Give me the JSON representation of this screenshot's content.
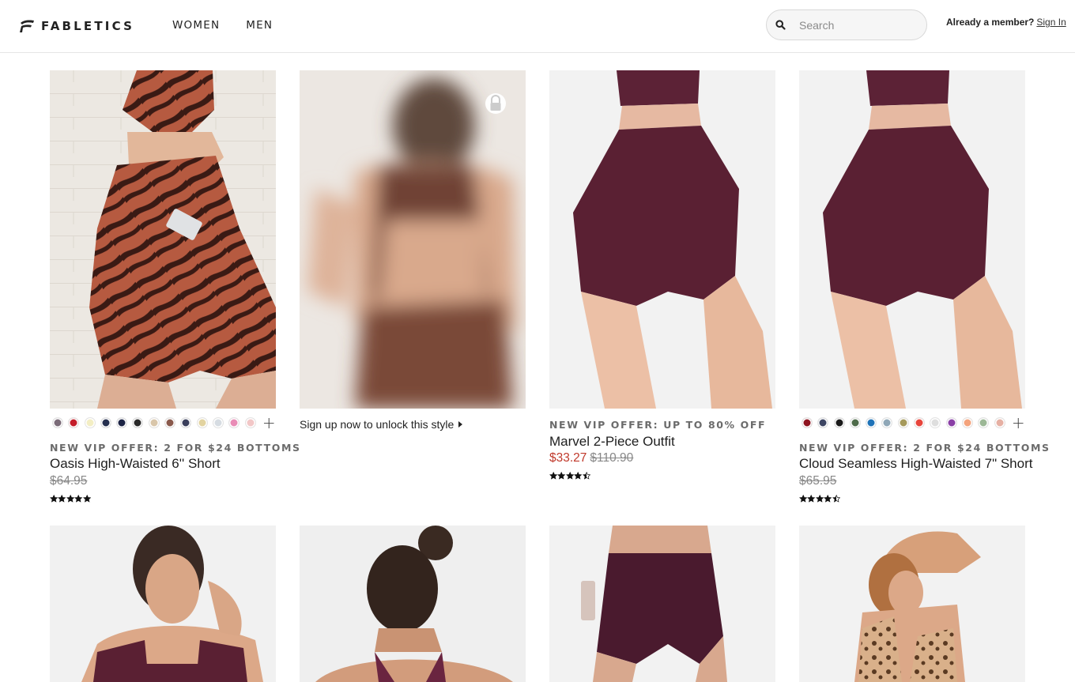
{
  "brand": "FABLETICS",
  "nav": [
    "WOMEN",
    "MEN"
  ],
  "search": {
    "placeholder": "Search"
  },
  "member": {
    "text": "Already a member?",
    "link": "Sign In"
  },
  "products": [
    {
      "offer": "NEW VIP OFFER: 2 FOR $24 BOTTOMS",
      "name": "Oasis High-Waisted 6'' Short",
      "price": "$64.95",
      "rating": 5,
      "swatches": [
        "#7a6b78",
        "#c41e2a",
        "#f3eec4",
        "#25304f",
        "#1d2445",
        "#2a2a2a",
        "#d9c6aa",
        "#8a5a4c",
        "#3a3f5c",
        "#e2d3a0",
        "#d6dce2",
        "#e98cb6",
        "#f2c7c7"
      ]
    },
    {
      "unlock": "Sign up now to unlock this style",
      "locked": true
    },
    {
      "offer": "NEW VIP OFFER: UP TO 80% OFF",
      "name": "Marvel 2-Piece Outfit",
      "sale_price": "$33.27",
      "price": "$110.90",
      "rating": 4.5
    },
    {
      "offer": "NEW VIP OFFER: 2 FOR $24 BOTTOMS",
      "name": "Cloud Seamless High-Waisted 7\" Short",
      "price": "$65.95",
      "rating": 4.5,
      "swatches": [
        "#8e1420",
        "#3d4563",
        "#1b1b1b",
        "#4e6b4a",
        "#1f73b8",
        "#8fa7b7",
        "#a69a5c",
        "#e8453c",
        "#dedede",
        "#8a3fa6",
        "#f4a37c",
        "#9cb896",
        "#e6b0a3"
      ]
    }
  ],
  "colors": {
    "accent": "#c0392b",
    "text": "#1e1e1e",
    "muted": "#6b6b6b"
  }
}
